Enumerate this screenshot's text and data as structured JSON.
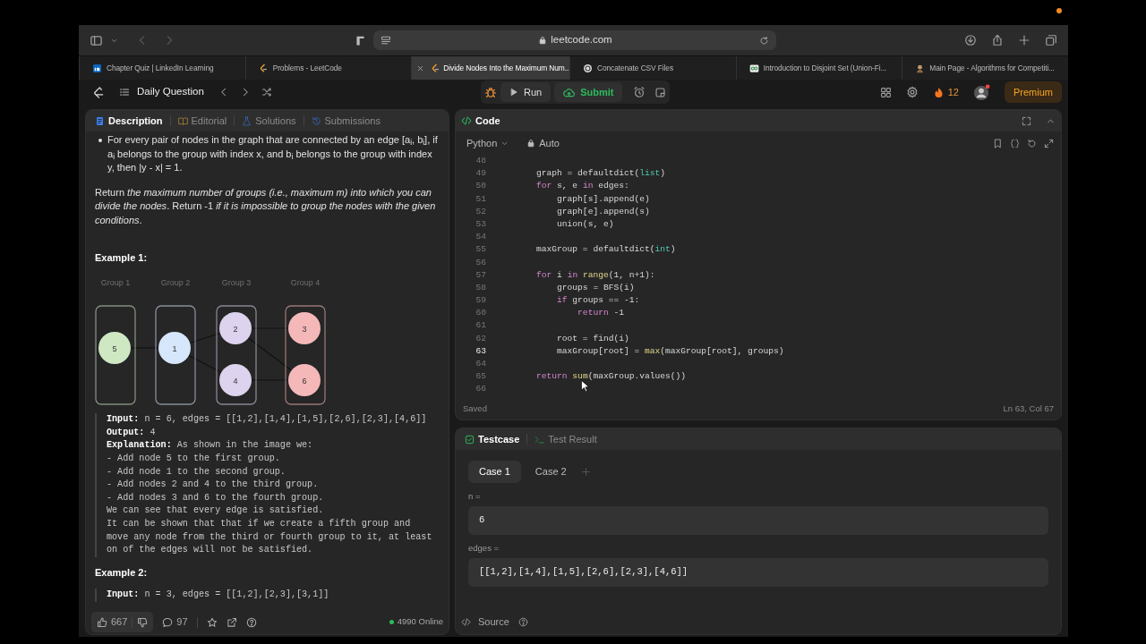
{
  "browser": {
    "url": "leetcode.com",
    "tabs": [
      {
        "title": "Chapter Quiz | LinkedIn Learning",
        "kind": "square",
        "selected": false
      },
      {
        "title": "Problems - LeetCode",
        "kind": "flame",
        "selected": false
      },
      {
        "title": "Divide Nodes Into the Maximum Num...",
        "kind": "flame",
        "selected": true
      },
      {
        "title": "Concatenate CSV Files",
        "kind": "knot",
        "selected": false
      },
      {
        "title": "Introduction to Disjoint Set (Union-Fi...",
        "kind": "loops",
        "selected": false
      },
      {
        "title": "Main Page - Algorithms for Competiti...",
        "kind": "emblem",
        "selected": false
      }
    ]
  },
  "nav": {
    "title": "Daily Question",
    "run": "Run",
    "submit": "Submit",
    "streak": "12",
    "premium": "Premium"
  },
  "problem": {
    "tabs": [
      {
        "label": "Description",
        "selected": true
      },
      {
        "label": "Editorial",
        "selected": false
      },
      {
        "label": "Solutions",
        "selected": false
      },
      {
        "label": "Submissions",
        "selected": false
      }
    ],
    "bullet": "For every pair of nodes in the graph that are connected by an edge [a$_{i}$, b$_{i}$], if a$_{i}$ belongs to the group with index x, and b$_{i}$ belongs to the group with index y, then |y - x| = 1.",
    "paragraph": "Return *the maximum number of groups (i.e., maximum m) into which you can divide the nodes*. Return -1 *if it is impossible to group the nodes with the given conditions*.",
    "examples": [
      {
        "heading": "Example 1:",
        "figure": {
          "groups": [
            {
              "label": "Group 1",
              "color": "#cfe8c4",
              "nodes": [
                "5"
              ]
            },
            {
              "label": "Group 2",
              "color": "#d6e6fb",
              "nodes": [
                "1"
              ]
            },
            {
              "label": "Group 3",
              "color": "#ddd3ee",
              "nodes": [
                "2",
                "4"
              ]
            },
            {
              "label": "Group 4",
              "color": "#f4b8b8",
              "nodes": [
                "3",
                "6"
              ]
            }
          ]
        },
        "lines": [
          "**Input:** n = 6, edges = [[1,2],[1,4],[1,5],[2,6],[2,3],[4,6]]",
          "**Output:** 4",
          "**Explanation:** As shown in the image we:",
          "- Add node 5 to the first group.",
          "- Add node 1 to the second group.",
          "- Add nodes 2 and 4 to the third group.",
          "- Add nodes 3 and 6 to the fourth group.",
          "We can see that every edge is satisfied.",
          "It can be shown that that if we create a fifth group and",
          "move any node from the third or fourth group to it, at least",
          "on of the edges will not be satisfied."
        ]
      },
      {
        "heading": "Example 2:",
        "lines": [
          "**Input:** n = 3, edges = [[1,2],[2,3],[3,1]]"
        ]
      }
    ],
    "footer": {
      "likes": "667",
      "comments": "97",
      "online": "4990 Online"
    }
  },
  "code": {
    "title": "Code",
    "language": "Python",
    "mode": "Auto",
    "status": "Saved",
    "cursor": "Ln 63, Col 67",
    "lines": [
      {
        "n": "48",
        "current": false
      },
      {
        "n": "49",
        "current": false,
        "s": [
          {
            "text": "        graph = defaultdict(",
            "kind": "plain"
          },
          {
            "text": "list",
            "kind": "type"
          },
          {
            "text": ")",
            "kind": "plain"
          }
        ]
      },
      {
        "n": "50",
        "current": false,
        "s": [
          {
            "text": "        for",
            "kind": "keyword"
          },
          {
            "text": " s, e ",
            "kind": "plain"
          },
          {
            "text": "in",
            "kind": "keyword"
          },
          {
            "text": " edges:",
            "kind": "plain"
          }
        ]
      },
      {
        "n": "51",
        "current": false,
        "s": [
          {
            "text": "            graph[s].append(e)",
            "kind": "plain"
          }
        ]
      },
      {
        "n": "52",
        "current": false,
        "s": [
          {
            "text": "            graph[e].append(s)",
            "kind": "plain"
          }
        ]
      },
      {
        "n": "53",
        "current": false,
        "s": [
          {
            "text": "            union(s, e)",
            "kind": "plain"
          }
        ]
      },
      {
        "n": "54",
        "current": false
      },
      {
        "n": "55",
        "current": false,
        "s": [
          {
            "text": "        maxGroup = defaultdict(",
            "kind": "plain"
          },
          {
            "text": "int",
            "kind": "type"
          },
          {
            "text": ")",
            "kind": "plain"
          }
        ]
      },
      {
        "n": "56",
        "current": false
      },
      {
        "n": "57",
        "current": false,
        "s": [
          {
            "text": "        for",
            "kind": "keyword"
          },
          {
            "text": " i ",
            "kind": "plain"
          },
          {
            "text": "in",
            "kind": "keyword"
          },
          {
            "text": " range",
            "kind": "func"
          },
          {
            "text": "(1, n+1):",
            "kind": "plain"
          }
        ]
      },
      {
        "n": "58",
        "current": false,
        "s": [
          {
            "text": "            groups = BFS(i)",
            "kind": "plain"
          }
        ]
      },
      {
        "n": "59",
        "current": false,
        "s": [
          {
            "text": "            if",
            "kind": "keyword"
          },
          {
            "text": " groups == -1:",
            "kind": "plain"
          }
        ]
      },
      {
        "n": "60",
        "current": false,
        "s": [
          {
            "text": "                return",
            "kind": "keyword"
          },
          {
            "text": " -1",
            "kind": "plain"
          }
        ]
      },
      {
        "n": "61",
        "current": false
      },
      {
        "n": "62",
        "current": false,
        "s": [
          {
            "text": "            root = find(i)",
            "kind": "plain"
          }
        ]
      },
      {
        "n": "63",
        "current": true,
        "s": [
          {
            "text": "            maxGroup[root] = ",
            "kind": "plain"
          },
          {
            "text": "max",
            "kind": "func"
          },
          {
            "text": "(maxGroup[root], groups)",
            "kind": "plain"
          }
        ]
      },
      {
        "n": "64",
        "current": false
      },
      {
        "n": "65",
        "current": false,
        "s": [
          {
            "text": "        return",
            "kind": "keyword"
          },
          {
            "text": " sum",
            "kind": "func"
          },
          {
            "text": "(maxGroup.values())",
            "kind": "plain"
          }
        ]
      },
      {
        "n": "66",
        "current": false
      }
    ]
  },
  "testcase": {
    "tabs": [
      {
        "label": "Testcase",
        "selected": true
      },
      {
        "label": "Test Result",
        "selected": false
      }
    ],
    "cases": [
      {
        "label": "Case 1",
        "selected": true
      },
      {
        "label": "Case 2",
        "selected": false
      }
    ],
    "inputs": [
      {
        "label": "n =",
        "value": "6"
      },
      {
        "label": "edges =",
        "value": "[[1,2],[1,4],[1,5],[2,6],[2,3],[4,6]]"
      }
    ],
    "source": "Source"
  }
}
